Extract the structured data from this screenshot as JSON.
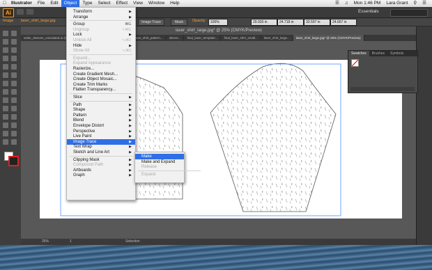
{
  "menubar": {
    "apple": "",
    "app_name": "Illustrator",
    "items": [
      "File",
      "Edit",
      "Object",
      "Type",
      "Select",
      "Effect",
      "View",
      "Window",
      "Help"
    ],
    "open_item": "Object",
    "clock": "Mon 1:46 PM",
    "user": "Lara Grant"
  },
  "appbar": {
    "logo": "Ai",
    "workspace": "Essentials"
  },
  "controlbar": {
    "image_label": "Image",
    "filename": "laser_shirt_large.jpg",
    "trace_button": "Image Trace",
    "mask_button": "Mask",
    "opacity_label": "Opacity",
    "opacity_value": "100%",
    "x_value": "29.933 in",
    "y_value": "24.718 in",
    "w_value": "33.597 in",
    "h_value": "24.667 in"
  },
  "document": {
    "active_title": "laser_shirt_large.jpg* @ 25% (CMYK/Preview)",
    "tabs": [
      "sailor_sleeves_calculated.ai @...",
      "laser_shirt.jpg...",
      "final_laser_font...",
      "laser_shirt_pattern...",
      "sleeve...",
      "final_laser_template...",
      "final_laser_shirt_small...",
      "laser_shirt_large...",
      "laser_shirt_large.jpg* @ 25% (CMYK/Preview)"
    ],
    "active_tab_index": 8
  },
  "statusbar": {
    "zoom": "25%",
    "page": "1",
    "mode": "Selection"
  },
  "swatches_panel": {
    "tabs": [
      "Swatches",
      "Brushes",
      "Symbols"
    ]
  },
  "object_menu": {
    "items": [
      {
        "label": "Transform",
        "arrow": true
      },
      {
        "label": "Arrange",
        "arrow": true
      },
      {
        "sep": true
      },
      {
        "label": "Group",
        "shortcut": "⌘G"
      },
      {
        "label": "Ungroup",
        "shortcut": "⇧⌘G",
        "disabled": true
      },
      {
        "label": "Lock",
        "arrow": true
      },
      {
        "label": "Unlock All",
        "shortcut": "⌥⌘2",
        "disabled": true
      },
      {
        "label": "Hide",
        "arrow": true
      },
      {
        "label": "Show All",
        "shortcut": "⌥⌘3",
        "disabled": true
      },
      {
        "sep": true
      },
      {
        "label": "Expand...",
        "disabled": true
      },
      {
        "label": "Expand Appearance",
        "disabled": true
      },
      {
        "label": "Rasterize..."
      },
      {
        "label": "Create Gradient Mesh..."
      },
      {
        "label": "Create Object Mosaic..."
      },
      {
        "label": "Create Trim Marks"
      },
      {
        "label": "Flatten Transparency..."
      },
      {
        "sep": true
      },
      {
        "label": "Slice",
        "arrow": true
      },
      {
        "sep": true
      },
      {
        "label": "Path",
        "arrow": true
      },
      {
        "label": "Shape",
        "arrow": true
      },
      {
        "label": "Pattern",
        "arrow": true
      },
      {
        "label": "Blend",
        "arrow": true
      },
      {
        "label": "Envelope Distort",
        "arrow": true
      },
      {
        "label": "Perspective",
        "arrow": true
      },
      {
        "label": "Live Paint",
        "arrow": true
      },
      {
        "label": "Image Trace",
        "arrow": true,
        "highlighted": true
      },
      {
        "label": "Text Wrap",
        "arrow": true
      },
      {
        "label": "Sketch and Line Art",
        "arrow": true
      },
      {
        "sep": true
      },
      {
        "label": "Clipping Mask",
        "arrow": true
      },
      {
        "label": "Compound Path",
        "arrow": true,
        "disabled": true
      },
      {
        "label": "Artboards",
        "arrow": true
      },
      {
        "label": "Graph",
        "arrow": true
      }
    ]
  },
  "image_trace_submenu": {
    "items": [
      {
        "label": "Make",
        "highlighted": true
      },
      {
        "label": "Make and Expand"
      },
      {
        "label": "Release",
        "disabled": true
      },
      {
        "sep": true
      },
      {
        "label": "Expand",
        "disabled": true
      }
    ]
  },
  "colors": {
    "accent": "#2f6ee6",
    "ai_orange": "#f7a23b",
    "app_dark": "#3b3b3b"
  }
}
